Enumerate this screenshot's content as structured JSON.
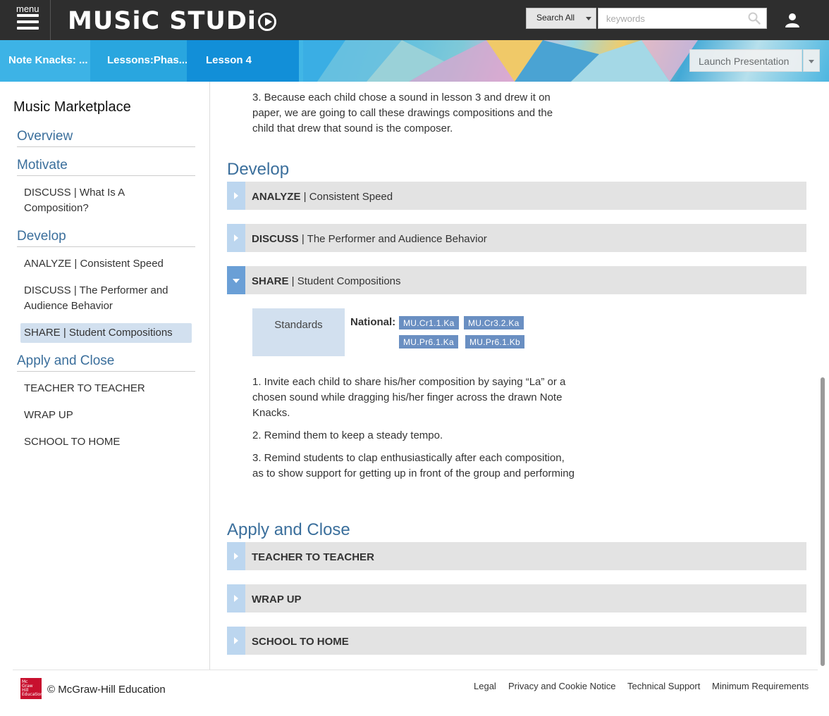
{
  "header": {
    "menu_label": "menu",
    "brand": "MUSiC STUDi",
    "search_scope": "Search All",
    "search_placeholder": "keywords"
  },
  "breadcrumbs": [
    "Note Knacks: ...",
    "Lessons:Phas...",
    "Lesson 4"
  ],
  "launch_label": "Launch Presentation",
  "sidebar": {
    "title": "Music Marketplace",
    "sections": [
      {
        "label": "Overview",
        "items": []
      },
      {
        "label": "Motivate",
        "items": [
          "DISCUSS | What Is A Composition?"
        ]
      },
      {
        "label": "Develop",
        "items": [
          "ANALYZE | Consistent Speed",
          "DISCUSS | The Performer and Audience Behavior",
          "SHARE | Student Compositions"
        ]
      },
      {
        "label": "Apply and Close",
        "items": [
          "TEACHER TO TEACHER",
          "WRAP UP",
          "SCHOOL TO HOME"
        ]
      }
    ]
  },
  "main": {
    "intro_text": "3. Because each child chose a sound in lesson 3 and drew it on paper, we are going to call these drawings compositions and the child that drew that sound is the composer.",
    "develop_heading": "Develop",
    "develop_items": [
      {
        "type": "ANALYZE",
        "title": "Consistent Speed"
      },
      {
        "type": "DISCUSS",
        "title": "The Performer and Audience Behavior"
      },
      {
        "type": "SHARE",
        "title": "Student Compositions"
      }
    ],
    "standards_label": "Standards",
    "national_label": "National:",
    "standards": [
      "MU.Cr1.1.Ka",
      "MU.Cr3.2.Ka",
      "MU.Pr6.1.Ka",
      "MU.Pr6.1.Kb"
    ],
    "share_steps": [
      "1. Invite each child to share his/her composition by saying “La” or a chosen sound while dragging his/her finger across the drawn Note Knacks.",
      "2. Remind them to keep a steady tempo.",
      "3. Remind students to clap enthusiastically after each composition, as to show support for getting up in front of the group and performing"
    ],
    "apply_heading": "Apply and Close",
    "apply_items": [
      "TEACHER TO TEACHER",
      "WRAP UP",
      "SCHOOL TO HOME"
    ]
  },
  "footer": {
    "logo_text": "Mc Graw Hill Education",
    "copyright": "© McGraw-Hill Education",
    "links": [
      "Legal",
      "Privacy and Cookie Notice",
      "Technical Support",
      "Minimum Requirements"
    ]
  },
  "colors": {
    "accent": "#3b6f9c",
    "header_bg": "#2e2e2e",
    "active_bg": "#d2e0ef",
    "tag_bg": "#6a8fc2"
  }
}
